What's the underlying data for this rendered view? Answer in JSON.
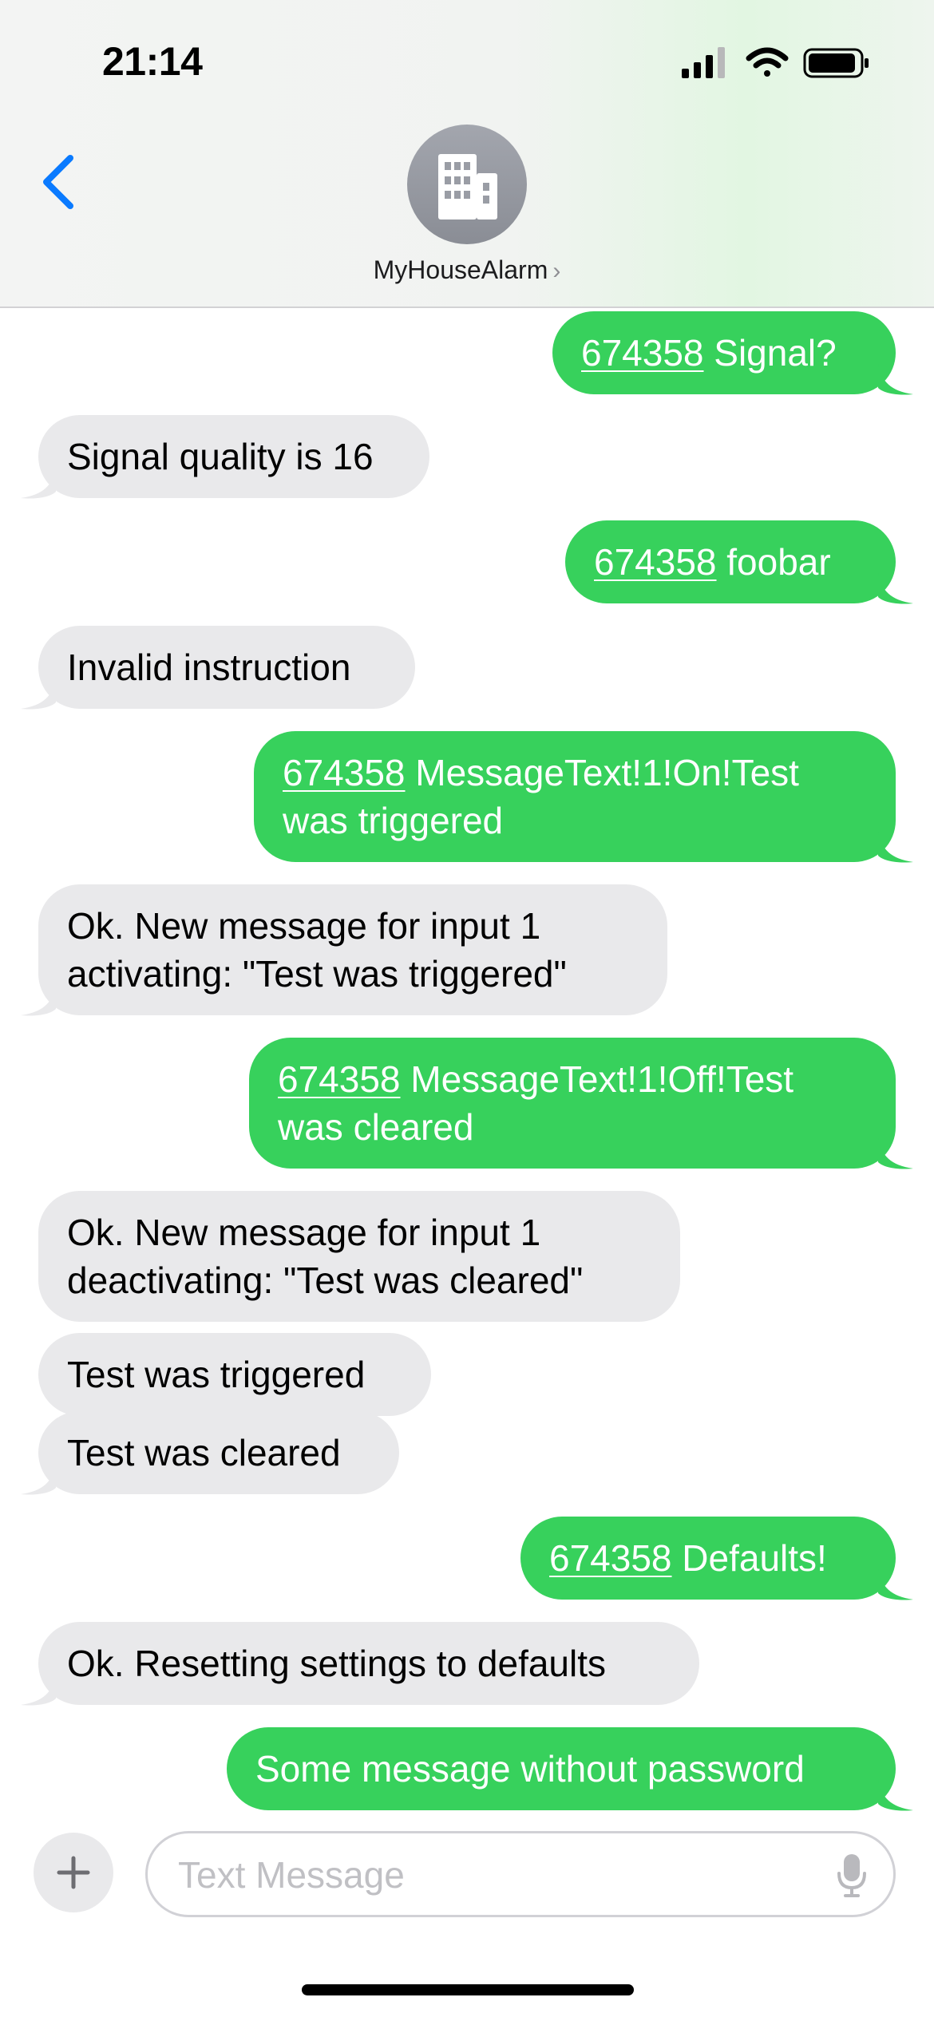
{
  "status_bar": {
    "time": "21:14"
  },
  "header": {
    "contact_name": "MyHouseAlarm",
    "contact_chevron": "›",
    "avatar_icon": "building-icon",
    "back_icon": "chevron-left-icon"
  },
  "messages": [
    {
      "direction": "sent",
      "password": "674358",
      "text": " Signal?"
    },
    {
      "direction": "received",
      "text": "Signal quality is 16"
    },
    {
      "direction": "sent",
      "password": "674358",
      "text": " foobar"
    },
    {
      "direction": "received",
      "text": "Invalid instruction"
    },
    {
      "direction": "sent",
      "password": "674358",
      "line1": " MessageText!1!On!Test",
      "line2": "was triggered"
    },
    {
      "direction": "received",
      "line1": "Ok. New message for input 1",
      "line2": "activating: \"Test was triggered\""
    },
    {
      "direction": "sent",
      "password": "674358",
      "line1": " MessageText!1!Off!Test",
      "line2": "was cleared"
    },
    {
      "direction": "received",
      "line1": "Ok. New message for input 1",
      "line2": "deactivating: \"Test was cleared\""
    },
    {
      "direction": "received",
      "text": "Test was triggered"
    },
    {
      "direction": "received",
      "text": "Test was cleared"
    },
    {
      "direction": "sent",
      "password": "674358",
      "text": " Defaults!"
    },
    {
      "direction": "received",
      "text": "Ok. Resetting settings to defaults"
    },
    {
      "direction": "sent",
      "text": "Some message without password"
    }
  ],
  "composer": {
    "placeholder": "Text Message",
    "plus_icon": "plus-icon",
    "mic_icon": "microphone-icon"
  },
  "colors": {
    "sent_bubble": "#37d15c",
    "received_bubble": "#e9e9eb",
    "accent": "#0a7aff"
  }
}
